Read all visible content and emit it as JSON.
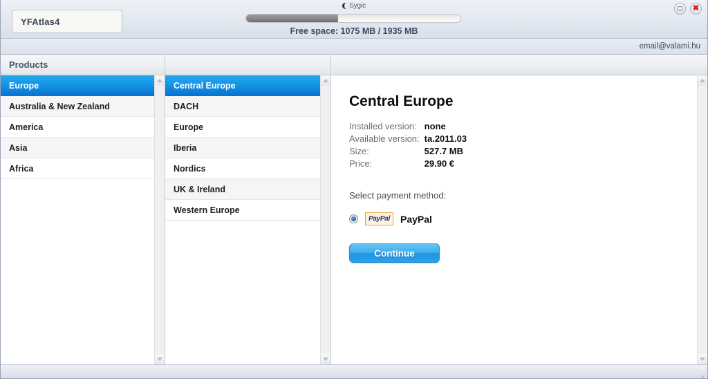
{
  "window": {
    "profile_name": "YFAtlas4",
    "brand": "Sygic",
    "brand_icon": "crescent-moon-icon",
    "minimize_icon": "restore-icon",
    "close_icon": "close-icon",
    "free_space_text": "Free space: 1075 MB / 1935 MB",
    "progress_percent": 43,
    "account_email": "email@valami.hu"
  },
  "products_column": {
    "header": "Products",
    "items": [
      {
        "label": "Europe",
        "selected": true
      },
      {
        "label": "Australia & New Zealand",
        "selected": false
      },
      {
        "label": "America",
        "selected": false
      },
      {
        "label": "Asia",
        "selected": false
      },
      {
        "label": "Africa",
        "selected": false
      }
    ]
  },
  "regions_column": {
    "header": "",
    "items": [
      {
        "label": "Central Europe",
        "selected": true
      },
      {
        "label": "DACH",
        "selected": false
      },
      {
        "label": "Europe",
        "selected": false
      },
      {
        "label": "Iberia",
        "selected": false
      },
      {
        "label": "Nordics",
        "selected": false
      },
      {
        "label": "UK & Ireland",
        "selected": false
      },
      {
        "label": "Western Europe",
        "selected": false
      }
    ]
  },
  "detail": {
    "title": "Central Europe",
    "specs": [
      {
        "label": "Installed version:",
        "value": "none"
      },
      {
        "label": "Available version:",
        "value": "ta.2011.03"
      },
      {
        "label": "Size:",
        "value": "527.7 MB"
      },
      {
        "label": "Price:",
        "value": "29.90 €"
      }
    ],
    "payment_prompt": "Select payment method:",
    "payment_methods": [
      {
        "logo_text": "PayPal",
        "name": "PayPal",
        "selected": true
      }
    ],
    "continue_label": "Continue"
  },
  "colors": {
    "accent_blue": "#1493e4",
    "selected_gradient_top": "#22aaf0",
    "selected_gradient_bottom": "#0a72cf",
    "paypal_border": "#e8a33d",
    "paypal_bg": "#fdf3dd",
    "paypal_text": "#25347f",
    "close_red": "#d32020",
    "title_text": "#3c4656"
  }
}
